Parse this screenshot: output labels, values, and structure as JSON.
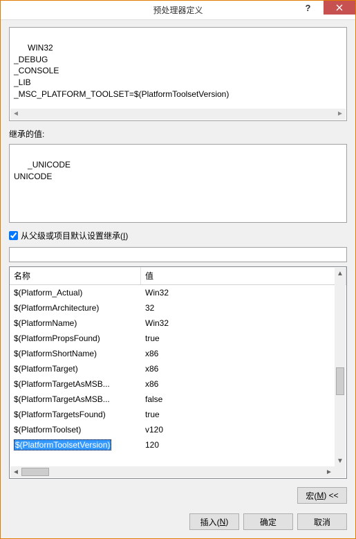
{
  "title": "预处理器定义",
  "main_definitions": "WIN32\n_DEBUG\n_CONSOLE\n_LIB\n_MSC_PLATFORM_TOOLSET=$(PlatformToolsetVersion)",
  "inherited_label": "继承的值:",
  "inherited_values": "_UNICODE\nUNICODE",
  "inherit_checkbox": {
    "checked": true,
    "label_pre": "从父级或项目默认设置继承(",
    "label_u": "I",
    "label_post": ")"
  },
  "result_value": "",
  "table": {
    "headers": {
      "name": "名称",
      "value": "值"
    },
    "rows": [
      {
        "name": "$(Platform_Actual)",
        "value": "Win32"
      },
      {
        "name": "$(PlatformArchitecture)",
        "value": "32"
      },
      {
        "name": "$(PlatformName)",
        "value": "Win32"
      },
      {
        "name": "$(PlatformPropsFound)",
        "value": "true"
      },
      {
        "name": "$(PlatformShortName)",
        "value": "x86"
      },
      {
        "name": "$(PlatformTarget)",
        "value": "x86"
      },
      {
        "name": "$(PlatformTargetAsMSB...",
        "value": "x86"
      },
      {
        "name": "$(PlatformTargetAsMSB...",
        "value": "false"
      },
      {
        "name": "$(PlatformTargetsFound)",
        "value": "true"
      },
      {
        "name": "$(PlatformToolset)",
        "value": "v120"
      },
      {
        "name": "$(PlatformToolsetVersion)",
        "value": "120"
      }
    ],
    "selected": 10
  },
  "buttons": {
    "macros_pre": "宏(",
    "macros_u": "M",
    "macros_post": ") <<",
    "insert_pre": "插入(",
    "insert_u": "N",
    "insert_post": ")",
    "ok": "确定",
    "cancel": "取消"
  }
}
